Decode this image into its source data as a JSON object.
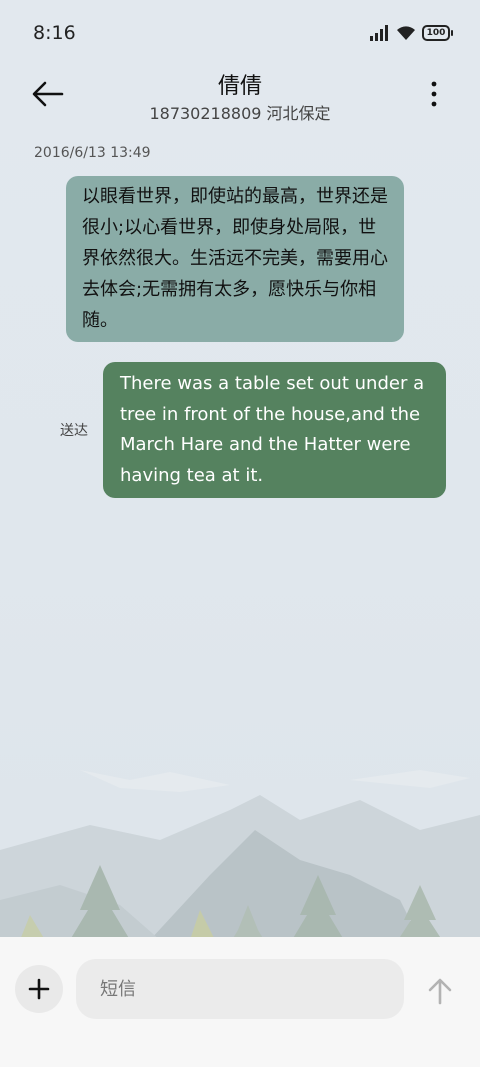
{
  "status_bar": {
    "time": "8:16",
    "battery": "100"
  },
  "header": {
    "contact_name": "倩倩",
    "contact_info": "18730218809 河北保定"
  },
  "conversation": {
    "timestamp": "2016/6/13 13:49",
    "incoming_message": "以眼看世界，即使站的最高，世界还是很小;以心看世界，即使身处局限，世界依然很大。生活远不完美，需要用心去体会;无需拥有太多，愿快乐与你相随。",
    "outgoing_message": "There was a table set out under a tree in front of the house,and the March Hare and the Hatter were having tea at it.",
    "outgoing_status": "送达"
  },
  "composer": {
    "placeholder": "短信"
  },
  "icons": {
    "signal": "signal-icon",
    "wifi": "wifi-icon",
    "battery": "battery-icon",
    "back": "back-arrow-icon",
    "more": "more-vertical-icon",
    "add": "plus-icon",
    "send": "send-arrow-icon"
  },
  "colors": {
    "incoming_bubble": "#8aaca7",
    "outgoing_bubble": "#55825f",
    "background": "#e0e7ed"
  }
}
